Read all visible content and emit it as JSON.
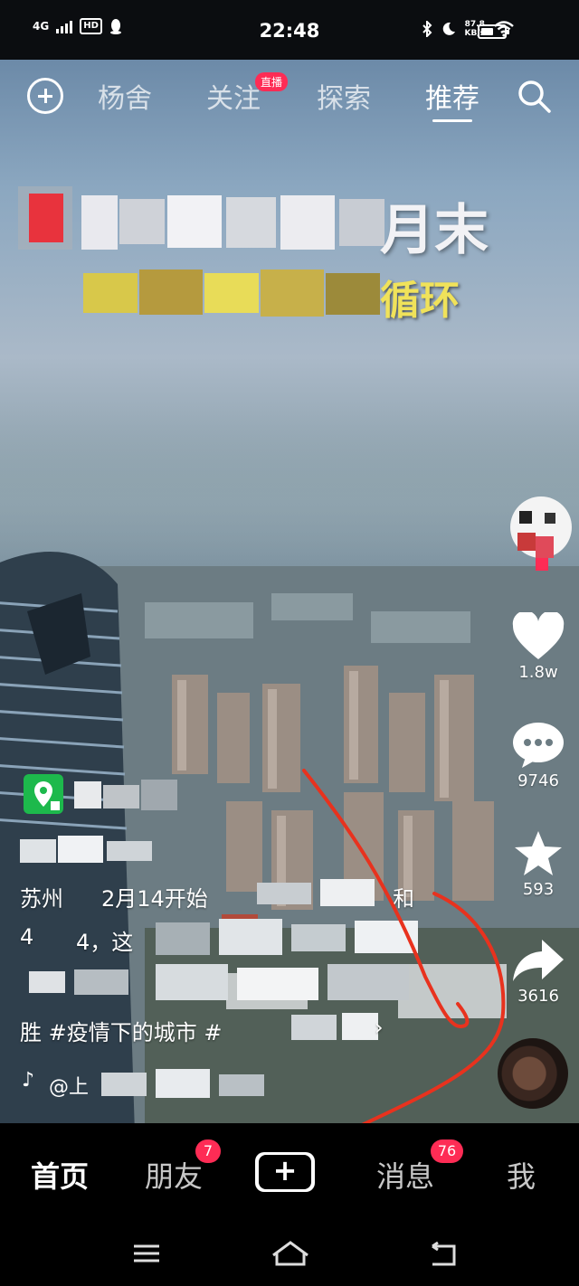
{
  "status_bar": {
    "network": "4G",
    "hd": "HD",
    "time": "22:48",
    "speed_value": "87.8",
    "speed_unit": "KB/s",
    "battery_level": 0.55
  },
  "top_nav": {
    "tabs": [
      "杨舍",
      "关注",
      "探索",
      "推荐"
    ],
    "active_tab": "推荐",
    "live_badge": "直播"
  },
  "video": {
    "caption_line1_visible": "月末",
    "caption_line2_visible": "循环"
  },
  "rail": {
    "likes": "1.8w",
    "comments": "9746",
    "favorites": "593",
    "shares": "3616"
  },
  "info": {
    "line1": "苏州",
    "line1b": "2月14开始",
    "line1c": "和",
    "line2": "4",
    "line2b": "4，这",
    "hashtags": "胜 #疫情下的城市 #",
    "sound_prefix": "@上"
  },
  "bottom_tabs": {
    "home": "首页",
    "friends": "朋友",
    "friends_badge": "7",
    "messages": "消息",
    "messages_badge": "76",
    "me": "我"
  },
  "colors": {
    "accent": "#fe2c55",
    "cyan": "#25f4ee",
    "annotation": "#e8321e"
  }
}
